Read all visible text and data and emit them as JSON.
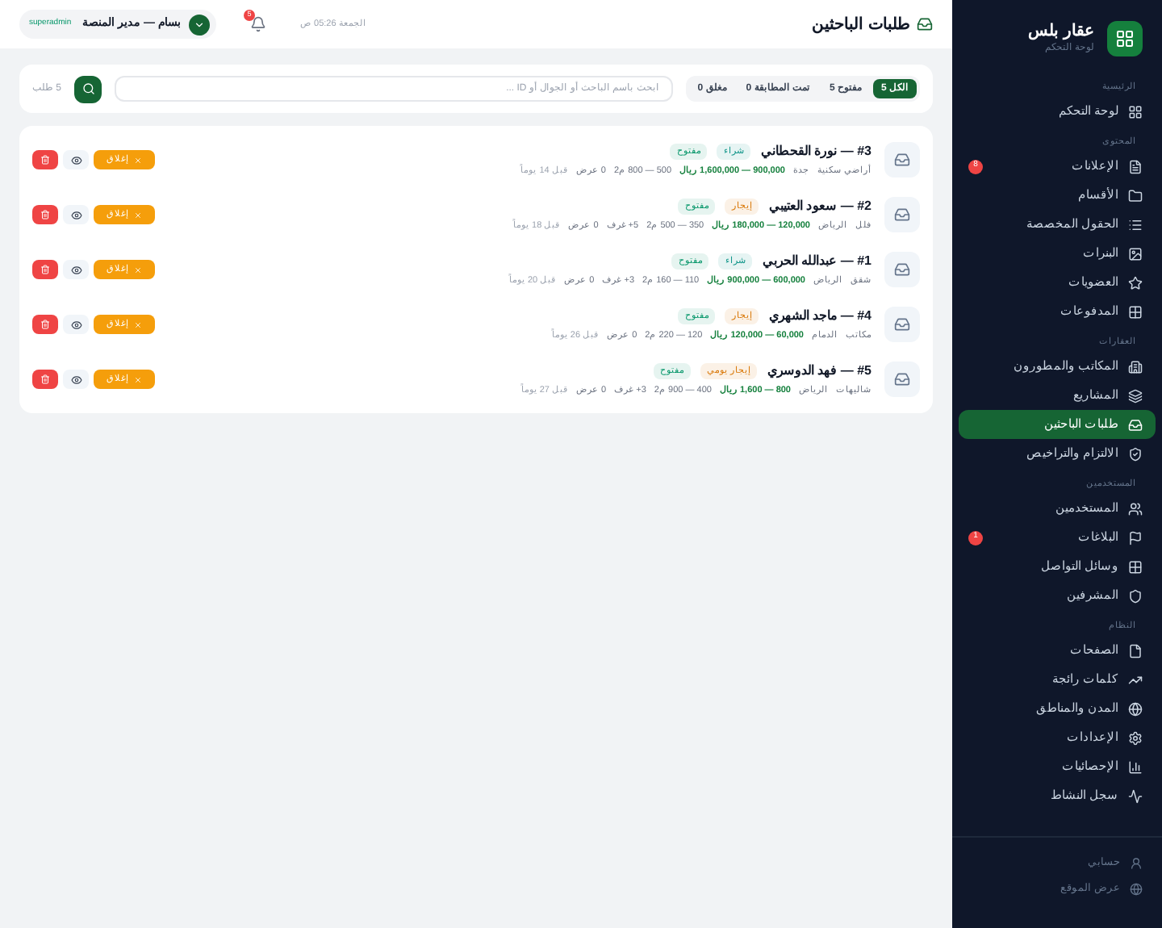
{
  "sidebar": {
    "brand": {
      "title": "عقار بلس",
      "subtitle": "لوحة التحكم"
    },
    "sections": [
      {
        "label": "الرئيسية",
        "items": [
          {
            "label": "لوحة التحكم",
            "selected": false
          }
        ]
      },
      {
        "label": "المحتوى",
        "items": [
          {
            "label": "الإعلانات",
            "selected": false,
            "badge": "8"
          },
          {
            "label": "الأقسام",
            "selected": false
          },
          {
            "label": "الحقول المخصصة",
            "selected": false
          },
          {
            "label": "البنرات",
            "selected": false
          },
          {
            "label": "العضويات",
            "selected": false
          },
          {
            "label": "المدفوعات",
            "selected": false
          }
        ]
      },
      {
        "label": "العقارات",
        "items": [
          {
            "label": "المكاتب والمطورون",
            "selected": false
          },
          {
            "label": "المشاريع",
            "selected": false
          },
          {
            "label": "طلبات الباحثين",
            "selected": true
          },
          {
            "label": "الالتزام والتراخيص",
            "selected": false
          }
        ]
      },
      {
        "label": "المستخدمين",
        "items": [
          {
            "label": "المستخدمين",
            "selected": false
          },
          {
            "label": "البلاغات",
            "selected": false,
            "badge": "1"
          },
          {
            "label": "وسائل التواصل",
            "selected": false
          },
          {
            "label": "المشرفين",
            "selected": false
          }
        ]
      },
      {
        "label": "النظام",
        "items": [
          {
            "label": "الصفحات",
            "selected": false
          },
          {
            "label": "كلمات رائجة",
            "selected": false
          },
          {
            "label": "المدن والمناطق",
            "selected": false
          },
          {
            "label": "الإعدادات",
            "selected": false
          },
          {
            "label": "الإحصائيات",
            "selected": false
          },
          {
            "label": "سجل النشاط",
            "selected": false
          }
        ]
      }
    ],
    "footer_items": [
      {
        "label": "حسابي"
      },
      {
        "label": "عرض الموقع"
      }
    ]
  },
  "header": {
    "title": "طلبات الباحثين",
    "datetime": "الجمعة 05:26 ص",
    "notifications": "5",
    "user": {
      "name": "بسام — مدير المنصة",
      "role": "superadmin"
    }
  },
  "filters": [
    {
      "label": "الكل 5",
      "selected": true
    },
    {
      "label": "مفتوح 5",
      "selected": false
    },
    {
      "label": "تمت المطابقة 0",
      "selected": false
    },
    {
      "label": "مغلق 0",
      "selected": false
    }
  ],
  "search": {
    "placeholder": "ابحث باسم الباحث أو الجوال أو ID ..."
  },
  "count": "5 طلب",
  "requests": [
    {
      "title": "#3 — نورة القحطاني",
      "tags": [
        {
          "label": "شراء",
          "color": "#0d9488"
        },
        {
          "label": "مفتوح",
          "color": "#059669"
        }
      ],
      "meta": [
        {
          "text": "أراضي سكنية",
          "kind": "plain"
        },
        {
          "text": "جدة",
          "kind": "plain"
        },
        {
          "text": "900,000 — 1,600,000 ريال",
          "kind": "price"
        },
        {
          "text": "500 — 800 م2",
          "kind": "plain"
        },
        {
          "text": "0 عرض",
          "kind": "plain"
        },
        {
          "text": "قبل 14 يوماً",
          "kind": "faint"
        }
      ],
      "close": "إغلاق"
    },
    {
      "title": "#2 — سعود العتيبي",
      "tags": [
        {
          "label": "إيجار",
          "color": "#d97706"
        },
        {
          "label": "مفتوح",
          "color": "#059669"
        }
      ],
      "meta": [
        {
          "text": "فلل",
          "kind": "plain"
        },
        {
          "text": "الرياض",
          "kind": "plain"
        },
        {
          "text": "120,000 — 180,000 ريال",
          "kind": "price"
        },
        {
          "text": "350 — 500 م2",
          "kind": "plain"
        },
        {
          "text": "5+ غرف",
          "kind": "plain"
        },
        {
          "text": "0 عرض",
          "kind": "plain"
        },
        {
          "text": "قبل 18 يوماً",
          "kind": "faint"
        }
      ],
      "close": "إغلاق"
    },
    {
      "title": "#1 — عبدالله الحربي",
      "tags": [
        {
          "label": "شراء",
          "color": "#0d9488"
        },
        {
          "label": "مفتوح",
          "color": "#059669"
        }
      ],
      "meta": [
        {
          "text": "شقق",
          "kind": "plain"
        },
        {
          "text": "الرياض",
          "kind": "plain"
        },
        {
          "text": "600,000 — 900,000 ريال",
          "kind": "price"
        },
        {
          "text": "110 — 160 م2",
          "kind": "plain"
        },
        {
          "text": "3+ غرف",
          "kind": "plain"
        },
        {
          "text": "0 عرض",
          "kind": "plain"
        },
        {
          "text": "قبل 20 يوماً",
          "kind": "faint"
        }
      ],
      "close": "إغلاق"
    },
    {
      "title": "#4 — ماجد الشهري",
      "tags": [
        {
          "label": "إيجار",
          "color": "#d97706"
        },
        {
          "label": "مفتوح",
          "color": "#059669"
        }
      ],
      "meta": [
        {
          "text": "مكاتب",
          "kind": "plain"
        },
        {
          "text": "الدمام",
          "kind": "plain"
        },
        {
          "text": "60,000 — 120,000 ريال",
          "kind": "price"
        },
        {
          "text": "120 — 220 م2",
          "kind": "plain"
        },
        {
          "text": "0 عرض",
          "kind": "plain"
        },
        {
          "text": "قبل 26 يوماً",
          "kind": "faint"
        }
      ],
      "close": "إغلاق"
    },
    {
      "title": "#5 — فهد الدوسري",
      "tags": [
        {
          "label": "إيجار يومي",
          "color": "#d97706"
        },
        {
          "label": "مفتوح",
          "color": "#059669"
        }
      ],
      "meta": [
        {
          "text": "شاليهات",
          "kind": "plain"
        },
        {
          "text": "الرياض",
          "kind": "plain"
        },
        {
          "text": "800 — 1,600 ريال",
          "kind": "price"
        },
        {
          "text": "400 — 900 م2",
          "kind": "plain"
        },
        {
          "text": "3+ غرف",
          "kind": "plain"
        },
        {
          "text": "0 عرض",
          "kind": "plain"
        },
        {
          "text": "قبل 27 يوماً",
          "kind": "faint"
        }
      ],
      "close": "إغلاق"
    }
  ]
}
